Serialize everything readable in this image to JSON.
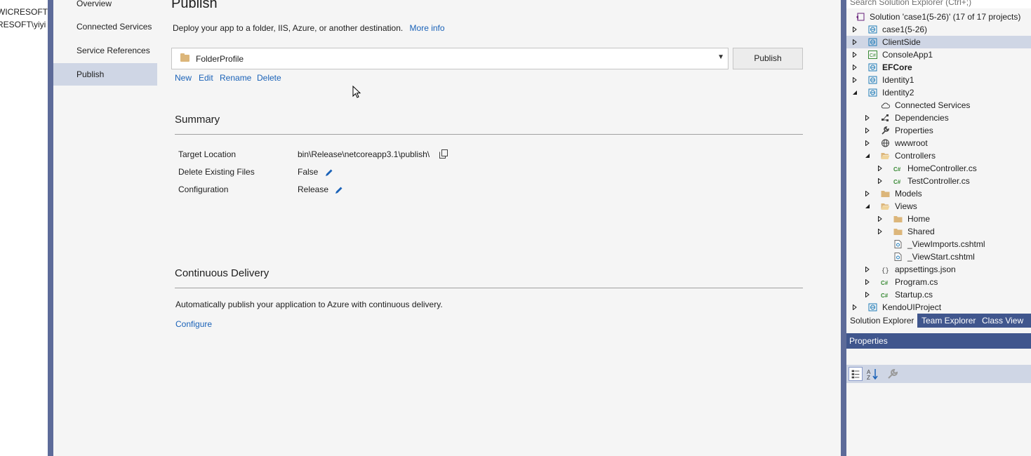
{
  "left_strip": [
    "WICRESOFT\\",
    "RESOFT\\yiyi"
  ],
  "nav": {
    "items": [
      "Overview",
      "Connected Services",
      "Service References",
      "Publish"
    ],
    "selected": "Publish"
  },
  "publish": {
    "title": "Publish",
    "description": "Deploy your app to a folder, IIS, Azure, or another destination.",
    "more_info": "More info",
    "profile": "FolderProfile",
    "publish_button": "Publish",
    "actions": [
      "New",
      "Edit",
      "Rename",
      "Delete"
    ]
  },
  "summary": {
    "title": "Summary",
    "rows": [
      {
        "label": "Target Location",
        "value": "bin\\Release\\netcoreapp3.1\\publish\\",
        "icon": "copy-icon"
      },
      {
        "label": "Delete Existing Files",
        "value": "False",
        "icon": "pencil-icon"
      },
      {
        "label": "Configuration",
        "value": "Release",
        "icon": "pencil-icon"
      }
    ]
  },
  "continuous_delivery": {
    "title": "Continuous Delivery",
    "description": "Automatically publish your application to Azure with continuous delivery.",
    "configure": "Configure"
  },
  "solution_explorer": {
    "search_placeholder": "Search Solution Explorer (Ctrl+;)",
    "solution_label": "Solution 'case1(5-26)' (17 of 17 projects)",
    "tree": [
      {
        "label": "case1(5-26)",
        "depth": 0,
        "expander": "collapsed",
        "icon": "web-project-icon"
      },
      {
        "label": "ClientSide",
        "depth": 0,
        "expander": "collapsed",
        "icon": "web-project-icon",
        "selected": true
      },
      {
        "label": "ConsoleApp1",
        "depth": 0,
        "expander": "collapsed",
        "icon": "csharp-project-icon"
      },
      {
        "label": "EFCore",
        "depth": 0,
        "expander": "collapsed",
        "icon": "web-project-icon",
        "bold": true
      },
      {
        "label": "Identity1",
        "depth": 0,
        "expander": "collapsed",
        "icon": "web-project-icon"
      },
      {
        "label": "Identity2",
        "depth": 0,
        "expander": "expanded",
        "icon": "web-project-icon"
      },
      {
        "label": "Connected Services",
        "depth": 1,
        "expander": "none",
        "icon": "cloud-icon"
      },
      {
        "label": "Dependencies",
        "depth": 1,
        "expander": "collapsed",
        "icon": "dependencies-icon"
      },
      {
        "label": "Properties",
        "depth": 1,
        "expander": "collapsed",
        "icon": "wrench-icon"
      },
      {
        "label": "wwwroot",
        "depth": 1,
        "expander": "collapsed",
        "icon": "globe-icon"
      },
      {
        "label": "Controllers",
        "depth": 1,
        "expander": "expanded",
        "icon": "folder-open-icon"
      },
      {
        "label": "HomeController.cs",
        "depth": 2,
        "expander": "collapsed",
        "icon": "csharp-file-icon"
      },
      {
        "label": "TestController.cs",
        "depth": 2,
        "expander": "collapsed",
        "icon": "csharp-file-icon"
      },
      {
        "label": "Models",
        "depth": 1,
        "expander": "collapsed",
        "icon": "folder-icon"
      },
      {
        "label": "Views",
        "depth": 1,
        "expander": "expanded",
        "icon": "folder-open-icon"
      },
      {
        "label": "Home",
        "depth": 2,
        "expander": "collapsed",
        "icon": "folder-icon"
      },
      {
        "label": "Shared",
        "depth": 2,
        "expander": "collapsed",
        "icon": "folder-icon"
      },
      {
        "label": "_ViewImports.cshtml",
        "depth": 2,
        "expander": "none",
        "icon": "razor-file-icon"
      },
      {
        "label": "_ViewStart.cshtml",
        "depth": 2,
        "expander": "none",
        "icon": "razor-file-icon"
      },
      {
        "label": "appsettings.json",
        "depth": 1,
        "expander": "collapsed",
        "icon": "json-file-icon"
      },
      {
        "label": "Program.cs",
        "depth": 1,
        "expander": "collapsed",
        "icon": "csharp-file-icon"
      },
      {
        "label": "Startup.cs",
        "depth": 1,
        "expander": "collapsed",
        "icon": "csharp-file-icon"
      },
      {
        "label": "KendoUIProject",
        "depth": 0,
        "expander": "collapsed",
        "icon": "web-project-icon"
      }
    ],
    "tabs": [
      "Solution Explorer",
      "Team Explorer",
      "Class View"
    ],
    "active_tab": "Solution Explorer"
  },
  "properties": {
    "title": "Properties",
    "toolbar": [
      "categorized-icon",
      "alphabetical-icon",
      "property-pages-icon"
    ]
  },
  "colors": {
    "accent_frame": "#5d6b99",
    "tool_header": "#40568d",
    "selection": "#cfd6e5",
    "link": "#1a62b8"
  }
}
